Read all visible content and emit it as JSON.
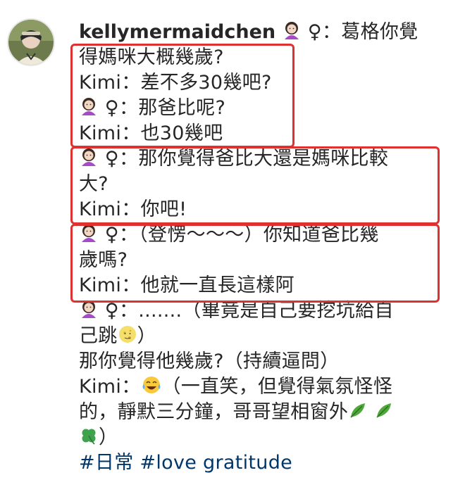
{
  "post": {
    "username": "kellymermaidchen",
    "caption": {
      "l1_tail": " ♀：葛格你覺",
      "l2": "得媽咪大概幾歲?",
      "l3": "Kimi：差不多30幾吧?",
      "l4_tail": " ♀：那爸比呢?",
      "l5": "Kimi：也30幾吧",
      "l6_tail": " ♀：那你覺得爸比大還是媽咪比較",
      "l7": "大?",
      "l8": "Kimi：你吧!",
      "l9_tail": " ♀：（登愣～～～）你知道爸比幾",
      "l10": "歲嗎?",
      "l11": "Kimi：他就一直長這樣阿",
      "l12_tail": " ♀：.......（畢竟是自己要挖坑給自",
      "l13_head": "己跳",
      "l13_tail": "）",
      "l14": "那你覺得他幾歲?（持續逼問）",
      "l15_head": "Kimi：",
      "l15_tail": "（一直笑，但覺得氣氛怪怪",
      "l16": "的，靜默三分鐘，哥哥望相窗外",
      "l17_tail": "）"
    },
    "hashtags": {
      "tag1": "#日常",
      "tag2": "#love",
      "text": "gratitude"
    }
  },
  "emojis": {
    "woman": "woman-icon",
    "moon_face": "full-moon-face-icon",
    "laughing": "tears-of-joy-icon",
    "leaf": "leaf-icon",
    "clover": "four-leaf-clover-icon"
  },
  "colors": {
    "text": "#262626",
    "hashtag": "#00376b",
    "highlight_border": "#e03131"
  }
}
